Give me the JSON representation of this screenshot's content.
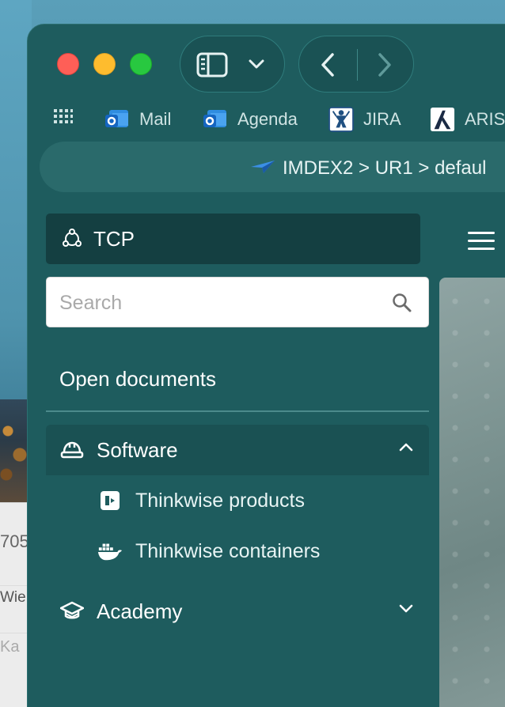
{
  "background": {
    "row1": "705",
    "row2": "Wie",
    "row3": "Ka"
  },
  "browser": {
    "bookmarks": [
      {
        "label": "Mail",
        "icon": "outlook-icon"
      },
      {
        "label": "Agenda",
        "icon": "outlook-icon"
      },
      {
        "label": "JIRA",
        "icon": "jira-icon"
      },
      {
        "label": "ARIS",
        "icon": "aris-icon"
      }
    ],
    "address": "IMDEX2 > UR1 > defaul"
  },
  "sidebar": {
    "app_title": "TCP",
    "search": {
      "placeholder": "Search",
      "value": ""
    },
    "open_documents": "Open documents",
    "groups": [
      {
        "label": "Software",
        "expanded": true,
        "items": [
          {
            "label": "Thinkwise products",
            "icon": "product-icon"
          },
          {
            "label": "Thinkwise containers",
            "icon": "docker-icon"
          }
        ]
      },
      {
        "label": "Academy",
        "expanded": false,
        "items": []
      }
    ]
  },
  "colors": {
    "window_bg": "#1e5c5e",
    "selected_bg": "#143f41",
    "accent": "#2f7c7c"
  }
}
